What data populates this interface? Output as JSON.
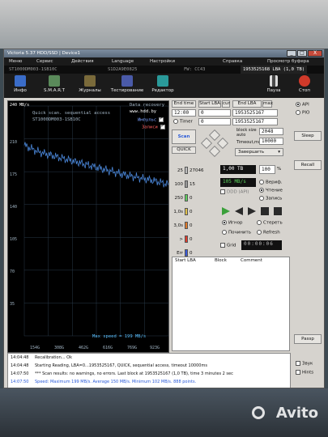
{
  "window": {
    "title": "Victoria 5.37 HDD/SSD | Device1",
    "minimize": "_",
    "maximize": "□",
    "close": "X"
  },
  "menu": {
    "items": [
      "Меню",
      "Сервис",
      "Действия",
      "Language",
      "Настройки",
      "Справка",
      "Просмотр буфера"
    ]
  },
  "infobar": {
    "model": "ST1000DM003-1SB10C",
    "serial": "S1D2A9E0825",
    "firmware": "FW: CC43",
    "lba": "1953525168 LBA (1,0 TB)"
  },
  "toolbar": {
    "buttons": [
      {
        "label": "Инфо",
        "color": "#3a6cc8"
      },
      {
        "label": "S.M.A.R.T",
        "color": "#5a8a5a"
      },
      {
        "label": "Журналы",
        "color": "#7a6a3a"
      },
      {
        "label": "Тестирование",
        "color": "#4a5aa8"
      },
      {
        "label": "Редактор",
        "color": "#2a9a9a"
      }
    ],
    "pause": "Пауза",
    "stop": "Стоп"
  },
  "graph": {
    "title": "Quick scan. sequential access",
    "model": "ST1000DM003-1SB10C",
    "recovery_title": "Data recovery",
    "recovery_url": "www.hdd.by",
    "impulse_label": "Импульс",
    "writes_label": "Записи",
    "speed_label": "Max speed = 199 MB/s",
    "y_ticks": [
      "240 MB/s",
      "210",
      "175",
      "140",
      "105",
      "70",
      "35"
    ],
    "x_ticks": [
      "154G",
      "308G",
      "462G",
      "616G",
      "769G",
      "923G"
    ]
  },
  "chart_data": {
    "type": "line",
    "x": [
      0,
      100,
      200,
      300,
      400,
      500,
      600,
      700,
      800,
      900,
      1000
    ],
    "series": [
      {
        "values": [
          199,
          192,
          188,
          184,
          180,
          176,
          172,
          168,
          165,
          162,
          158
        ]
      }
    ],
    "xlabel": "",
    "ylabel": "",
    "ylim": [
      0,
      240
    ]
  },
  "panel": {
    "end_time": "End time",
    "start_lba_label": "Start LBA",
    "cur_label": "cur",
    "end_lba_label": "End LBA",
    "max_label": "max",
    "start_time": "12:00",
    "start_lba": "0",
    "end_lba": "1953525167",
    "timer_label": "Timer",
    "timer_value": "0",
    "end_lba_2": "1953525167",
    "block_size_label": "block size",
    "auto_label": "auto",
    "block_size": "2048",
    "timeout_label": "Timeout,ms",
    "timeout": "10000",
    "scan": "Scan",
    "quick": "QUICK",
    "mode": "Завершить",
    "size": "1,00 TB",
    "percent": "100",
    "percent_unit": "%",
    "speed": "105 MB/s",
    "verify": "Вериф.",
    "read": "Чтение",
    "write": "Запись",
    "ddd": "DDD (API)",
    "ignore": "Игнор",
    "erase": "Стереть",
    "fix": "Починить",
    "refresh": "Refresh",
    "grid": "Grid",
    "time": "00:00:06"
  },
  "blocks": [
    {
      "ms": "25",
      "count": "27046",
      "color": "#bdbdbd"
    },
    {
      "ms": "100",
      "count": "15",
      "color": "#9a9a9a"
    },
    {
      "ms": "250",
      "count": "0",
      "color": "#5fd15f"
    },
    {
      "ms": "1,0s",
      "count": "0",
      "color": "#e0c04a"
    },
    {
      "ms": "3,0s",
      "count": "0",
      "color": "#e07a2a"
    },
    {
      "ms": ">",
      "count": "0",
      "color": "#e03a2a"
    },
    {
      "ms": "Err",
      "count": "0",
      "color": "#3a5ad8"
    }
  ],
  "table": {
    "cols": [
      "Start LBA",
      "Block",
      "Comment"
    ]
  },
  "side": {
    "api": "API",
    "pio": "PIO",
    "sleep": "Sleep",
    "recall": "Recall",
    "passp": "Passp",
    "sound": "Звук",
    "hints": "Hints"
  },
  "log": [
    {
      "t": "14:04:48",
      "m": "Recalibration... Ok",
      "c": "#222"
    },
    {
      "t": "14:04:48",
      "m": "Starting Reading, LBA=0...1953525167, QUICK, sequential access, timeout 10000ms",
      "c": "#222"
    },
    {
      "t": "14:07:50",
      "m": "*** Scan results: no warnings, no errors. Last block at 1953525167 (1,0 TB), time 3 minutes 2 sec",
      "c": "#222"
    },
    {
      "t": "14:07:50",
      "m": "Speed: Maximum 199 MB/s. Average 150 MB/s. Minimum 102 MB/s. 888 points.",
      "c": "#2a5ad8"
    }
  ],
  "watermark": "Avito"
}
